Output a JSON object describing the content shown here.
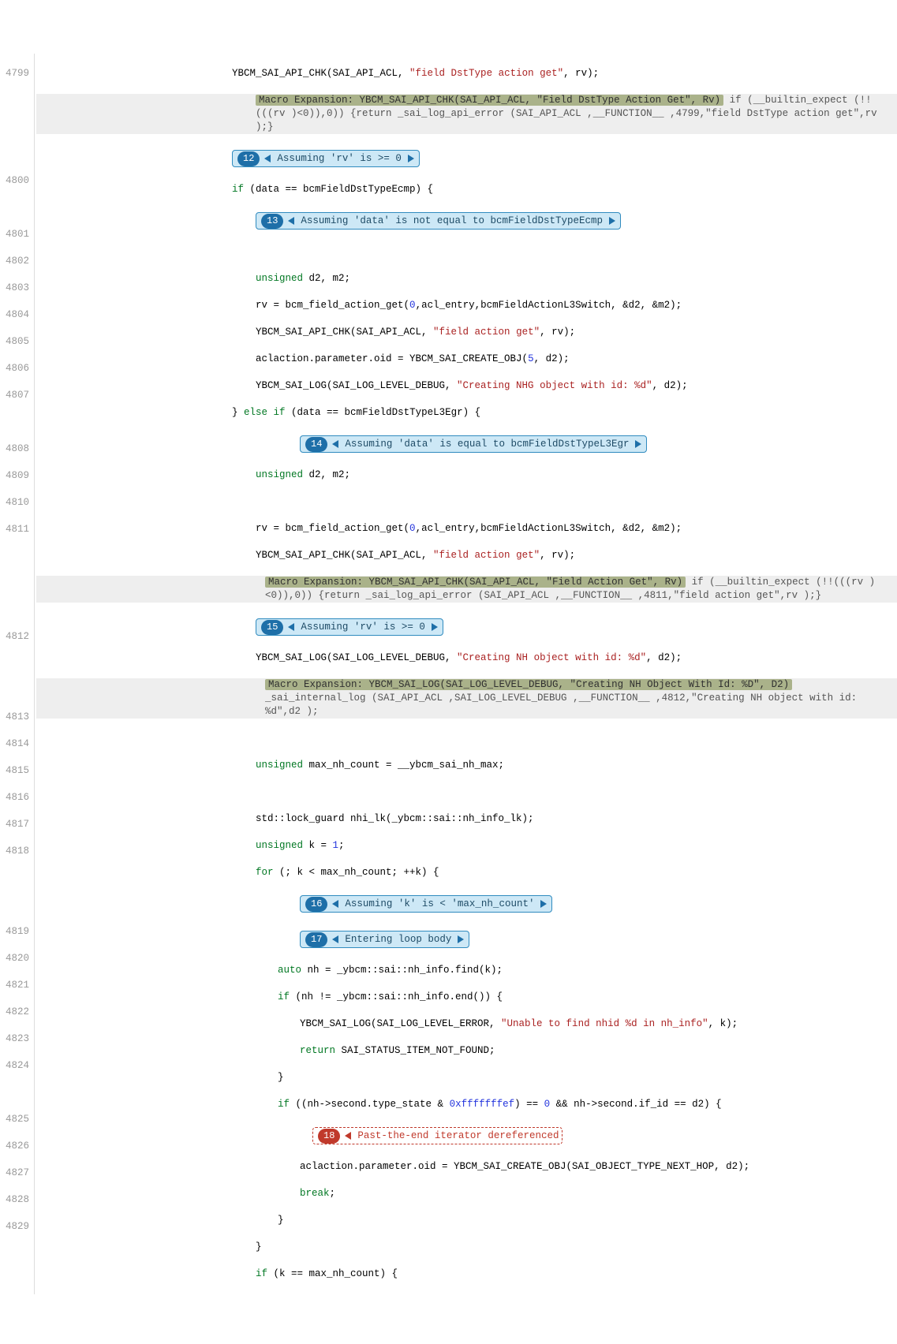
{
  "lines": {
    "4799": "4799",
    "4800": "4800",
    "4801": "4801",
    "4802": "4802",
    "4803": "4803",
    "4804": "4804",
    "4805": "4805",
    "4806": "4806",
    "4807": "4807",
    "4808": "4808",
    "4809": "4809",
    "4810": "4810",
    "4811": "4811",
    "4812": "4812",
    "4813": "4813",
    "4814": "4814",
    "4815": "4815",
    "4816": "4816",
    "4817": "4817",
    "4818": "4818",
    "4819": "4819",
    "4820": "4820",
    "4821": "4821",
    "4822": "4822",
    "4823": "4823",
    "4824": "4824",
    "4825": "4825",
    "4826": "4826",
    "4827": "4827",
    "4828": "4828",
    "4829": "4829"
  },
  "c": {
    "l4799a": "YBCM_SAI_API_CHK(SAI_API_ACL, ",
    "l4799s": "\"field DstType action get\"",
    "l4799b": ", rv);",
    "me1": "Macro Expansion: YBCM_SAI_API_CHK(SAI_API_ACL, \"Field DstType Action Get\", Rv)",
    "me1tail": " if (__builtin_expect (!!(((rv )<0)),0)) {return _sai_log_api_error (SAI_API_ACL ,__FUNCTION__ ,4799,\"field DstType action get\",rv );}",
    "n12": "12",
    "n12m": "Assuming 'rv' is >= 0",
    "l4800a": "if",
    "l4800b": " (data == bcmFieldDstTypeEcmp) {",
    "n13": "13",
    "n13m": "Assuming 'data' is not equal to bcmFieldDstTypeEcmp",
    "l4802a": "unsigned",
    "l4802b": " d2, m2;",
    "l4803a": "rv = bcm_field_action_get(",
    "l4803n": "0",
    "l4803b": ",acl_entry,bcmFieldActionL3Switch, &d2, &m2);",
    "l4804a": "YBCM_SAI_API_CHK(SAI_API_ACL, ",
    "l4804s": "\"field action get\"",
    "l4804b": ", rv);",
    "l4805a": "aclaction.parameter.oid = YBCM_SAI_CREATE_OBJ(",
    "l4805n": "5",
    "l4805b": ", d2);",
    "l4806a": "YBCM_SAI_LOG(SAI_LOG_LEVEL_DEBUG, ",
    "l4806s": "\"Creating NHG object with id: %d\"",
    "l4806b": ", d2);",
    "l4807a": "} ",
    "l4807k1": "else",
    "l4807k2": " if",
    "l4807b": " (data == bcmFieldDstTypeL3Egr) {",
    "n14": "14",
    "n14m": "Assuming 'data' is equal to bcmFieldDstTypeL3Egr",
    "l4808a": "unsigned",
    "l4808b": " d2, m2;",
    "l4810a": "rv = bcm_field_action_get(",
    "l4810n": "0",
    "l4810b": ",acl_entry,bcmFieldActionL3Switch, &d2, &m2);",
    "l4811a": "YBCM_SAI_API_CHK(SAI_API_ACL, ",
    "l4811s": "\"field action get\"",
    "l4811b": ", rv);",
    "me2": "Macro Expansion: YBCM_SAI_API_CHK(SAI_API_ACL, \"Field Action Get\", Rv)",
    "me2tail": " if (__builtin_expect (!!(((rv )<0)),0)) {return _sai_log_api_error (SAI_API_ACL ,__FUNCTION__ ,4811,\"field action get\",rv );}",
    "n15": "15",
    "n15m": "Assuming 'rv' is >= 0",
    "l4812a": "YBCM_SAI_LOG(SAI_LOG_LEVEL_DEBUG, ",
    "l4812s": "\"Creating NH object with id: %d\"",
    "l4812b": ", d2);",
    "me3": "Macro Expansion: YBCM_SAI_LOG(SAI_LOG_LEVEL_DEBUG, \"Creating NH Object With Id: %D\", D2)",
    "me3tail": " _sai_internal_log (SAI_API_ACL ,SAI_LOG_LEVEL_DEBUG ,__FUNCTION__ ,4812,\"Creating NH object with id: %d\",d2 );",
    "l4814a": "unsigned",
    "l4814b": " max_nh_count = __ybcm_sai_nh_max;",
    "l4816": "std::lock_guard nhi_lk(_ybcm::sai::nh_info_lk);",
    "l4817a": "unsigned",
    "l4817b": " k = ",
    "l4817n": "1",
    "l4817c": ";",
    "l4818a": "for",
    "l4818b": " (; k < max_nh_count; ++k) {",
    "n16": "16",
    "n16m": "Assuming 'k' is < 'max_nh_count'",
    "n17": "17",
    "n17m": "Entering loop body",
    "l4819a": "auto",
    "l4819b": " nh = _ybcm::sai::nh_info.find(k);",
    "l4820a": "if",
    "l4820b": " (nh != _ybcm::sai::nh_info.end()) {",
    "l4821a": "YBCM_SAI_LOG(SAI_LOG_LEVEL_ERROR, ",
    "l4821s": "\"Unable to find nhid %d in nh_info\"",
    "l4821b": ", k);",
    "l4822a": "return",
    "l4822b": " SAI_STATUS_ITEM_NOT_FOUND;",
    "l4823": "}",
    "l4824a": "if",
    "l4824b": " ((nh->second.type_state & ",
    "l4824n1": "0xfffffffef",
    "l4824c": ") == ",
    "l4824n2": "0",
    "l4824d": " && nh->second.if_id == d2) {",
    "n18": "18",
    "n18m": "Past-the-end iterator dereferenced",
    "l4825": "aclaction.parameter.oid = YBCM_SAI_CREATE_OBJ(SAI_OBJECT_TYPE_NEXT_HOP, d2);",
    "l4826a": "break",
    "l4826b": ";",
    "l4827": "}",
    "l4828": "}",
    "l4829a": "if",
    "l4829b": " (k == max_nh_count) {"
  }
}
